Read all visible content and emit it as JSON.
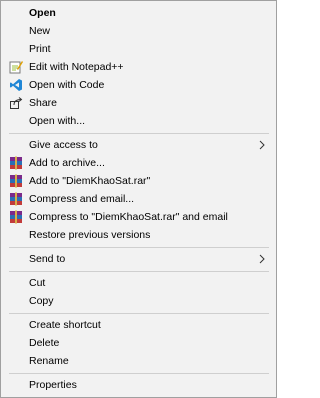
{
  "menu": {
    "open": "Open",
    "new": "New",
    "print": "Print",
    "edit_notepad": "Edit with Notepad++",
    "open_code": "Open with Code",
    "share": "Share",
    "open_with": "Open with...",
    "give_access": "Give access to",
    "add_archive": "Add to archive...",
    "add_rar": "Add to \"DiemKhaoSat.rar\"",
    "compress_email": "Compress and email...",
    "compress_rar_email": "Compress to \"DiemKhaoSat.rar\" and email",
    "restore": "Restore previous versions",
    "send_to": "Send to",
    "cut": "Cut",
    "copy": "Copy",
    "create_shortcut": "Create shortcut",
    "delete": "Delete",
    "rename": "Rename",
    "properties": "Properties"
  },
  "icons": {
    "notepad": "notepad-plus-icon",
    "vscode": "vscode-icon",
    "share": "share-icon",
    "winrar": "winrar-icon"
  },
  "colors": {
    "menu_bg": "#f2f2f2",
    "separator": "#cfcfcf",
    "vscode_blue": "#1f86d6"
  }
}
